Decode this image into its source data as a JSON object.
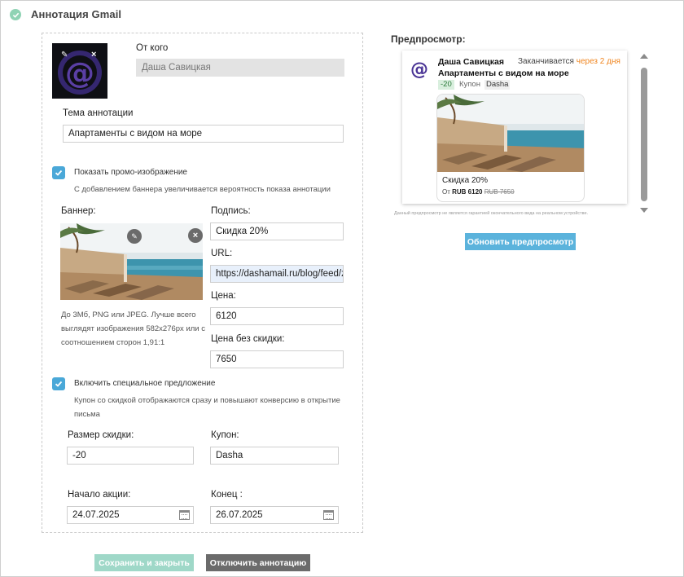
{
  "header": {
    "title": "Аннотация Gmail"
  },
  "form": {
    "from_label": "От кого",
    "from_value": "Даша Савицкая",
    "subject_label": "Тема аннотации",
    "subject_value": "Апартаменты с видом на море",
    "promo_checkbox_label": "Показать промо-изображение",
    "promo_checked": true,
    "promo_hint": "С добавлением баннера увеличивается вероятность показа аннотации",
    "banner_label": "Баннер:",
    "banner_hint_lines": [
      "До 3Мб, PNG или JPEG. Лучше всего",
      "выглядят изображения 582x276px или с",
      "соотношением сторон 1,91:1"
    ],
    "caption_label": "Подпись:",
    "caption_value": "Скидка 20%",
    "url_label": "URL:",
    "url_value": "https://dashamail.ru/blog/feed/z",
    "price_label": "Цена:",
    "price_value": "6120",
    "old_price_label": "Цена без скидки:",
    "old_price_value": "7650",
    "offer_checkbox_label": "Включить специальное предложение",
    "offer_checked": true,
    "offer_hint_lines": [
      "Купон со скидкой отображаются сразу и повышают конверсию в открытие",
      "письма"
    ],
    "discount_label": "Размер скидки:",
    "discount_value": "-20",
    "coupon_label": "Купон:",
    "coupon_value": "Dasha",
    "start_label": "Начало акции:",
    "start_value": "24.07.2025",
    "end_label": "Конец :",
    "end_value": "26.07.2025"
  },
  "buttons": {
    "save": "Сохранить и закрыть",
    "disable": "Отключить аннотацию",
    "refresh": "Обновить предпросмотр"
  },
  "preview": {
    "title": "Предпросмотр:",
    "sender": "Даша Савицкая",
    "expires_prefix": "Заканчивается",
    "expires_highlight": "через 2 дня",
    "subject": "Апартаменты с видом на море",
    "discount_badge": "-20",
    "coupon_label": "Купон",
    "coupon_value": "Dasha",
    "caption": "Скидка 20%",
    "price_prefix": "От",
    "price": "RUB 6120",
    "old_price": "RUB 7650",
    "note": "Данный предпросмотр не является гарантией окончательного вида на реальном устройстве."
  },
  "colors": {
    "accent_blue": "#4aa8d8",
    "save_button_disabled": "#9fd8c8",
    "disable_button": "#6b6b6b",
    "refresh_button": "#5bb3dc",
    "expires_highlight": "#f0851f",
    "check_green": "#8fd3b4"
  },
  "icons": [
    "check-icon",
    "at-sign-logo",
    "pencil-icon",
    "close-icon",
    "calendar-icon"
  ]
}
